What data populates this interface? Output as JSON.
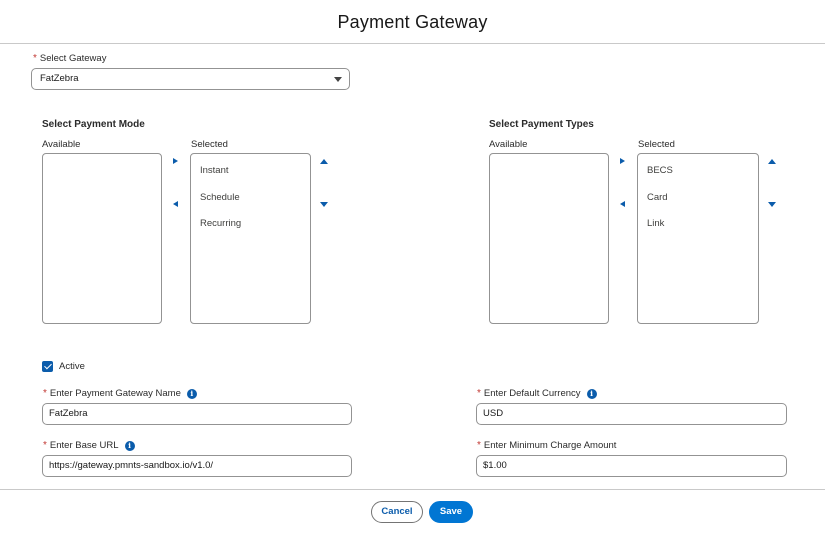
{
  "header": {
    "title": "Payment Gateway"
  },
  "gateway": {
    "label": "Select Gateway",
    "value": "FatZebra"
  },
  "payment_mode": {
    "title": "Select Payment Mode",
    "available_label": "Available",
    "selected_label": "Selected",
    "available": [],
    "selected": [
      "Instant",
      "Schedule",
      "Recurring"
    ]
  },
  "payment_types": {
    "title": "Select Payment Types",
    "available_label": "Available",
    "selected_label": "Selected",
    "available": [],
    "selected": [
      "BECS",
      "Card",
      "Link"
    ]
  },
  "active": {
    "label": "Active",
    "checked": true
  },
  "fields": {
    "gateway_name": {
      "label": "Enter Payment Gateway Name",
      "value": "FatZebra"
    },
    "base_url": {
      "label": "Enter Base URL",
      "value": "https://gateway.pmnts-sandbox.io/v1.0/"
    },
    "default_currency": {
      "label": "Enter Default Currency",
      "value": "USD"
    },
    "min_charge": {
      "label": "Enter Minimum Charge Amount",
      "value": "$1.00"
    }
  },
  "footer": {
    "cancel_label": "Cancel",
    "save_label": "Save"
  },
  "colors": {
    "brand": "#0176d3",
    "accent": "#0b5cab",
    "required": "#c23934"
  },
  "icons": {
    "info": "info-icon",
    "caret": "chevron-down-icon"
  }
}
